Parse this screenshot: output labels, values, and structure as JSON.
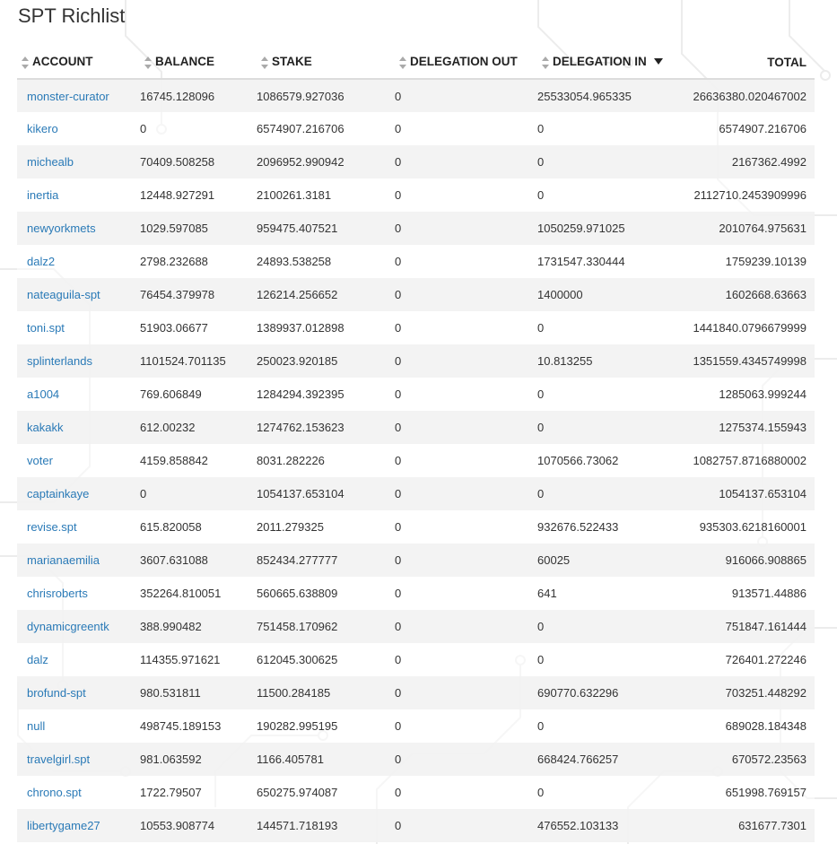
{
  "page": {
    "title": "SPT Richlist"
  },
  "colors": {
    "link": "#2a7ab7",
    "row_stripe": "#f2f2f2",
    "text": "#333333"
  },
  "table": {
    "columns": [
      "ACCOUNT",
      "BALANCE",
      "STAKE",
      "DELEGATION OUT",
      "DELEGATION IN",
      "TOTAL"
    ],
    "sorted_by": "TOTAL",
    "sort_direction": "descending",
    "rows": [
      {
        "account": "monster-curator",
        "balance": "16745.128096",
        "stake": "1086579.927036",
        "delegation_out": "0",
        "delegation_in": "25533054.965335",
        "total": "26636380.020467002"
      },
      {
        "account": "kikero",
        "balance": "0",
        "stake": "6574907.216706",
        "delegation_out": "0",
        "delegation_in": "0",
        "total": "6574907.216706"
      },
      {
        "account": "michealb",
        "balance": "70409.508258",
        "stake": "2096952.990942",
        "delegation_out": "0",
        "delegation_in": "0",
        "total": "2167362.4992"
      },
      {
        "account": "inertia",
        "balance": "12448.927291",
        "stake": "2100261.3181",
        "delegation_out": "0",
        "delegation_in": "0",
        "total": "2112710.2453909996"
      },
      {
        "account": "newyorkmets",
        "balance": "1029.597085",
        "stake": "959475.407521",
        "delegation_out": "0",
        "delegation_in": "1050259.971025",
        "total": "2010764.975631"
      },
      {
        "account": "dalz2",
        "balance": "2798.232688",
        "stake": "24893.538258",
        "delegation_out": "0",
        "delegation_in": "1731547.330444",
        "total": "1759239.10139"
      },
      {
        "account": "nateaguila-spt",
        "balance": "76454.379978",
        "stake": "126214.256652",
        "delegation_out": "0",
        "delegation_in": "1400000",
        "total": "1602668.63663"
      },
      {
        "account": "toni.spt",
        "balance": "51903.06677",
        "stake": "1389937.012898",
        "delegation_out": "0",
        "delegation_in": "0",
        "total": "1441840.0796679999"
      },
      {
        "account": "splinterlands",
        "balance": "1101524.701135",
        "stake": "250023.920185",
        "delegation_out": "0",
        "delegation_in": "10.813255",
        "total": "1351559.4345749998"
      },
      {
        "account": "a1004",
        "balance": "769.606849",
        "stake": "1284294.392395",
        "delegation_out": "0",
        "delegation_in": "0",
        "total": "1285063.999244"
      },
      {
        "account": "kakakk",
        "balance": "612.00232",
        "stake": "1274762.153623",
        "delegation_out": "0",
        "delegation_in": "0",
        "total": "1275374.155943"
      },
      {
        "account": "voter",
        "balance": "4159.858842",
        "stake": "8031.282226",
        "delegation_out": "0",
        "delegation_in": "1070566.73062",
        "total": "1082757.8716880002"
      },
      {
        "account": "captainkaye",
        "balance": "0",
        "stake": "1054137.653104",
        "delegation_out": "0",
        "delegation_in": "0",
        "total": "1054137.653104"
      },
      {
        "account": "revise.spt",
        "balance": "615.820058",
        "stake": "2011.279325",
        "delegation_out": "0",
        "delegation_in": "932676.522433",
        "total": "935303.6218160001"
      },
      {
        "account": "marianaemilia",
        "balance": "3607.631088",
        "stake": "852434.277777",
        "delegation_out": "0",
        "delegation_in": "60025",
        "total": "916066.908865"
      },
      {
        "account": "chrisroberts",
        "balance": "352264.810051",
        "stake": "560665.638809",
        "delegation_out": "0",
        "delegation_in": "641",
        "total": "913571.44886"
      },
      {
        "account": "dynamicgreentk",
        "balance": "388.990482",
        "stake": "751458.170962",
        "delegation_out": "0",
        "delegation_in": "0",
        "total": "751847.161444"
      },
      {
        "account": "dalz",
        "balance": "114355.971621",
        "stake": "612045.300625",
        "delegation_out": "0",
        "delegation_in": "0",
        "total": "726401.272246"
      },
      {
        "account": "brofund-spt",
        "balance": "980.531811",
        "stake": "11500.284185",
        "delegation_out": "0",
        "delegation_in": "690770.632296",
        "total": "703251.448292"
      },
      {
        "account": "null",
        "balance": "498745.189153",
        "stake": "190282.995195",
        "delegation_out": "0",
        "delegation_in": "0",
        "total": "689028.184348"
      },
      {
        "account": "travelgirl.spt",
        "balance": "981.063592",
        "stake": "1166.405781",
        "delegation_out": "0",
        "delegation_in": "668424.766257",
        "total": "670572.23563"
      },
      {
        "account": "chrono.spt",
        "balance": "1722.79507",
        "stake": "650275.974087",
        "delegation_out": "0",
        "delegation_in": "0",
        "total": "651998.769157"
      },
      {
        "account": "libertygame27",
        "balance": "10553.908774",
        "stake": "144571.718193",
        "delegation_out": "0",
        "delegation_in": "476552.103133",
        "total": "631677.7301"
      }
    ]
  }
}
